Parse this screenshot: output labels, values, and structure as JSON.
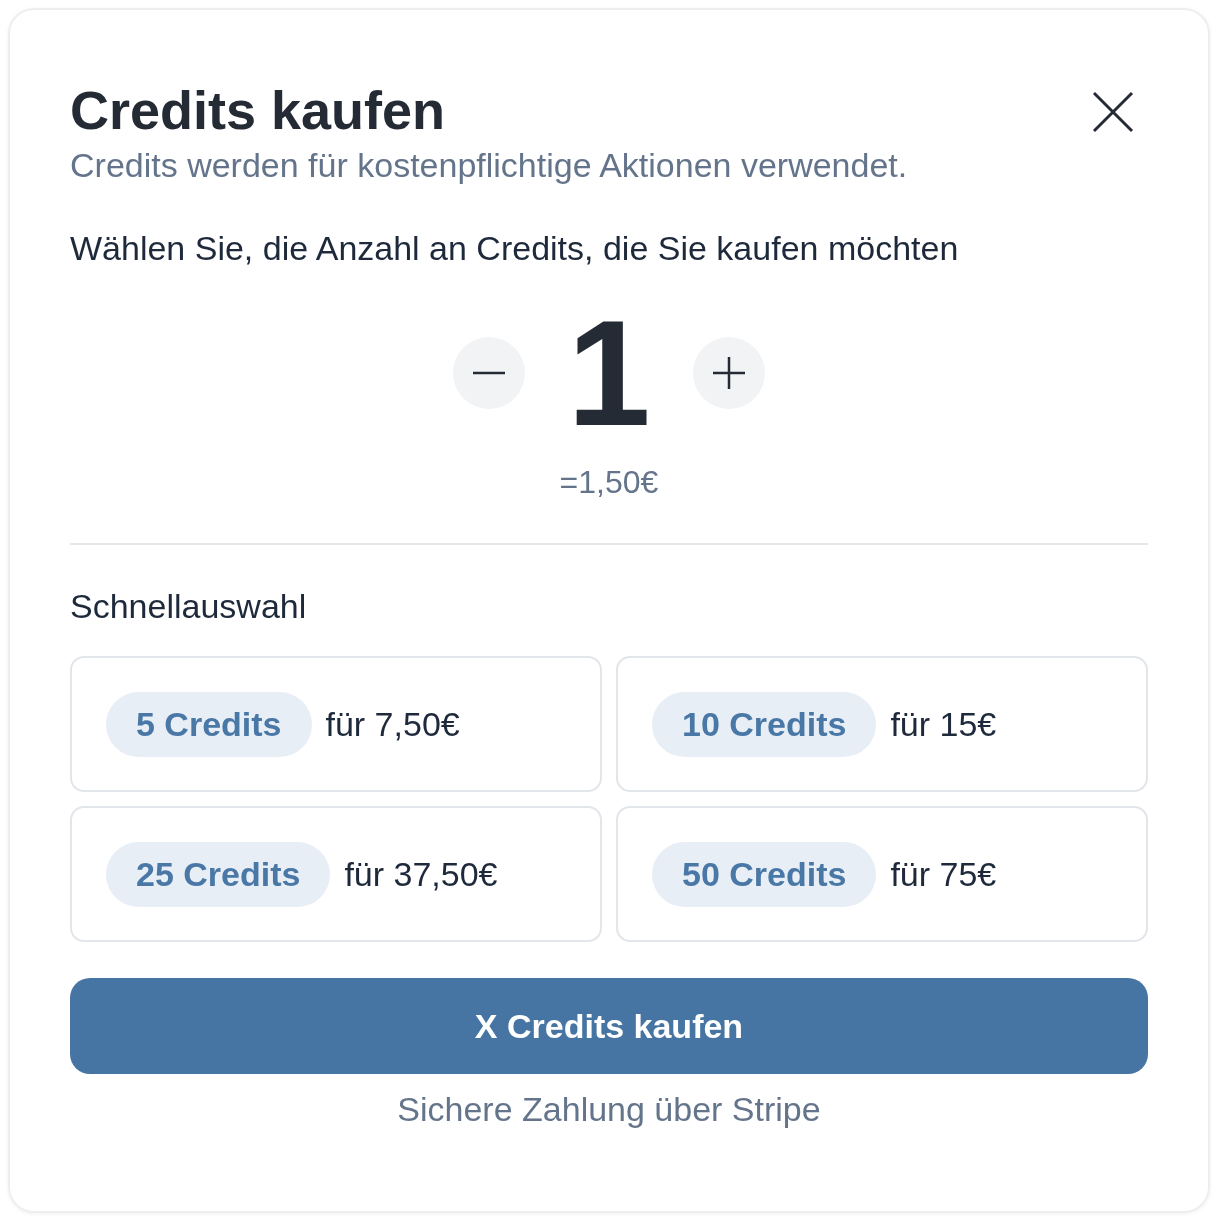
{
  "dialog": {
    "title": "Credits kaufen",
    "subtitle": "Credits werden für kostenpflichtige Aktionen verwendet."
  },
  "selector": {
    "prompt": "Wählen Sie, die Anzahl an Credits, die Sie kaufen möchten",
    "quantity": "1",
    "price": "=1,50€"
  },
  "quick_select": {
    "title": "Schnellauswahl",
    "options": [
      {
        "credits": "5 Credits",
        "price": "für 7,50€"
      },
      {
        "credits": "10 Credits",
        "price": "für 15€"
      },
      {
        "credits": "25 Credits",
        "price": "für 37,50€"
      },
      {
        "credits": "50 Credits",
        "price": "für 75€"
      }
    ]
  },
  "buy_button": "X Credits kaufen",
  "footer": "Sichere Zahlung über Stripe"
}
